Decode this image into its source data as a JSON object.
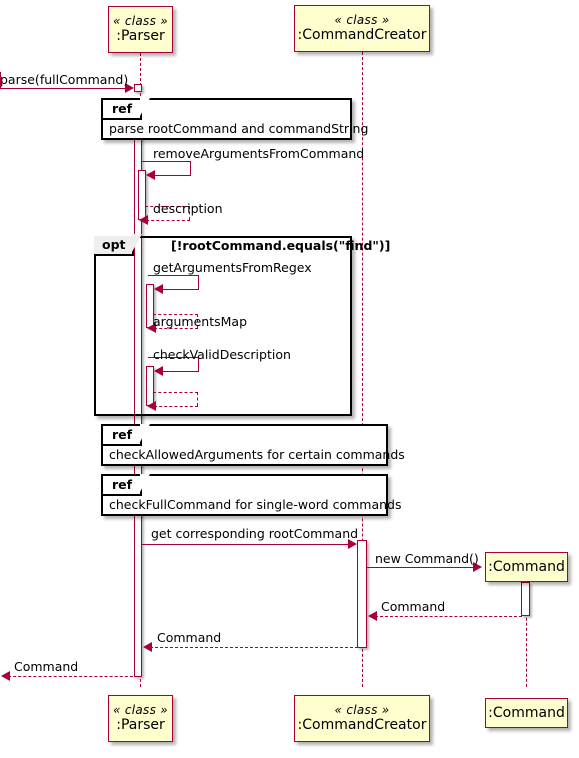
{
  "diagram": {
    "kind": "uml-sequence-diagram",
    "colors": {
      "participant_fill": "#FEFECE",
      "participant_border": "#A80036",
      "message_line": "#A80036",
      "fragment_border": "#000000",
      "fragment_tab_fill": "#EEEEEE",
      "background": "#FFFFFF"
    }
  },
  "participants": [
    {
      "stereotype": "« class »",
      "name": ":Parser"
    },
    {
      "stereotype": "« class »",
      "name": ":CommandCreator"
    },
    {
      "stereotype": "",
      "name": ":Command"
    }
  ],
  "participants_bottom": [
    {
      "stereotype": "« class »",
      "name": ":Parser"
    },
    {
      "stereotype": "« class »",
      "name": ":CommandCreator"
    },
    {
      "stereotype": "",
      "name": ":Command"
    }
  ],
  "messages": [
    {
      "id": "m1",
      "label": "parse(fullCommand)",
      "from": "actor-boundary",
      "to": ":Parser",
      "type": "sync"
    },
    {
      "id": "m2",
      "label": "removeArgumentsFromCommand",
      "from": ":Parser",
      "to": ":Parser",
      "type": "self"
    },
    {
      "id": "m3",
      "label": "description",
      "from": ":Parser",
      "to": ":Parser",
      "type": "return"
    },
    {
      "id": "m4",
      "label": "getArgumentsFromRegex",
      "from": ":Parser",
      "to": ":Parser",
      "type": "self"
    },
    {
      "id": "m5",
      "label": "argumentsMap",
      "from": ":Parser",
      "to": ":Parser",
      "type": "return"
    },
    {
      "id": "m6",
      "label": "checkValidDescription",
      "from": ":Parser",
      "to": ":Parser",
      "type": "self"
    },
    {
      "id": "m7",
      "label": "",
      "from": ":Parser",
      "to": ":Parser",
      "type": "return"
    },
    {
      "id": "m8",
      "label": "get corresponding rootCommand",
      "from": ":Parser",
      "to": ":CommandCreator",
      "type": "sync"
    },
    {
      "id": "m9",
      "label": "new Command()",
      "from": ":CommandCreator",
      "to": ":Command",
      "type": "create"
    },
    {
      "id": "m10",
      "label": "Command",
      "from": ":Command",
      "to": ":CommandCreator",
      "type": "return"
    },
    {
      "id": "m11",
      "label": "Command",
      "from": ":CommandCreator",
      "to": ":Parser",
      "type": "return"
    },
    {
      "id": "m12",
      "label": "Command",
      "from": ":Parser",
      "to": "actor-boundary",
      "type": "return"
    }
  ],
  "fragments": [
    {
      "id": "opt1",
      "operator": "opt",
      "condition": "[!rootCommand.equals(\"find\")]"
    }
  ],
  "refs": [
    {
      "id": "ref1",
      "operator": "ref",
      "text": "parse rootCommand and commandString"
    },
    {
      "id": "ref2",
      "operator": "ref",
      "text": "checkAllowedArguments for certain commands"
    },
    {
      "id": "ref3",
      "operator": "ref",
      "text": "checkFullCommand for single-word commands"
    }
  ]
}
